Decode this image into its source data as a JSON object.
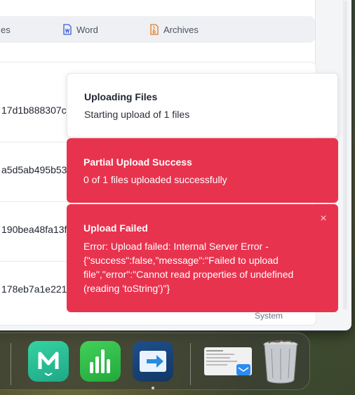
{
  "filters": {
    "partial_label": "es",
    "word_label": "Word",
    "archives_label": "Archives"
  },
  "table": {
    "rows": [
      {
        "hash": "17d1b888307c"
      },
      {
        "hash": "a5d5ab495b53"
      },
      {
        "hash": "190bea48fa13f"
      },
      {
        "hash": "178eb7a1e221"
      }
    ],
    "system_label": "System"
  },
  "toasts": {
    "info": {
      "title": "Uploading Files",
      "body": "Starting upload of 1 files"
    },
    "warning": {
      "title": "Partial Upload Success",
      "body": "0 of 1 files uploaded successfully"
    },
    "error": {
      "title": "Upload Failed",
      "body": "Error: Upload failed: Internal Server Error - {\"success\":false,\"message\":\"Failed to upload file\",\"error\":\"Cannot read properties of undefined (reading 'toString')\"}",
      "close_glyph": "×"
    }
  },
  "colors": {
    "error_toast": "#e8334f",
    "accent_word": "#3b5bdb",
    "accent_archives": "#e07b24"
  },
  "dock": {
    "apps": [
      {
        "name": "mindnode-icon"
      },
      {
        "name": "numbers-icon"
      },
      {
        "name": "transmit-icon"
      },
      {
        "name": "mail-preview-icon"
      },
      {
        "name": "trash-icon"
      }
    ]
  }
}
